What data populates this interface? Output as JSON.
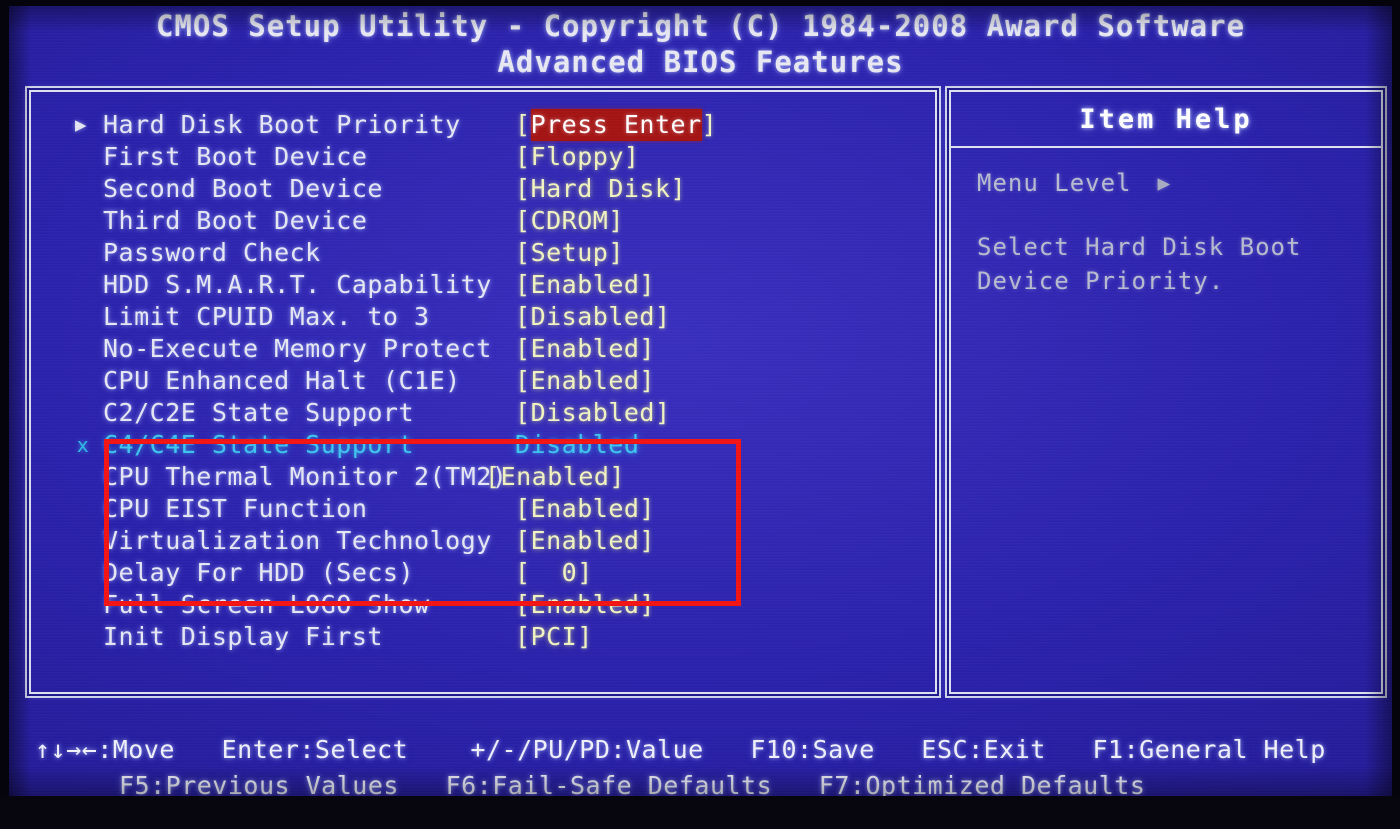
{
  "title": {
    "line1": "CMOS Setup Utility - Copyright (C) 1984-2008 Award Software",
    "line2": "Advanced BIOS Features"
  },
  "menu": {
    "items": [
      {
        "marker": "▶",
        "label": "Hard Disk Boot Priority",
        "value": "Press Enter",
        "brackets": true,
        "highlighted": true,
        "inactive": false
      },
      {
        "marker": "",
        "label": "First Boot Device",
        "value": "Floppy",
        "brackets": true,
        "highlighted": false,
        "inactive": false
      },
      {
        "marker": "",
        "label": "Second Boot Device",
        "value": "Hard Disk",
        "brackets": true,
        "highlighted": false,
        "inactive": false
      },
      {
        "marker": "",
        "label": "Third Boot Device",
        "value": "CDROM",
        "brackets": true,
        "highlighted": false,
        "inactive": false
      },
      {
        "marker": "",
        "label": "Password Check",
        "value": "Setup",
        "brackets": true,
        "highlighted": false,
        "inactive": false
      },
      {
        "marker": "",
        "label": "HDD S.M.A.R.T. Capability",
        "value": "Enabled",
        "brackets": true,
        "highlighted": false,
        "inactive": false
      },
      {
        "marker": "",
        "label": "Limit CPUID Max. to 3",
        "value": "Disabled",
        "brackets": true,
        "highlighted": false,
        "inactive": false
      },
      {
        "marker": "",
        "label": "No-Execute Memory Protect",
        "value": "Enabled",
        "brackets": true,
        "highlighted": false,
        "inactive": false
      },
      {
        "marker": "",
        "label": "CPU Enhanced Halt (C1E)",
        "value": "Enabled",
        "brackets": true,
        "highlighted": false,
        "inactive": false
      },
      {
        "marker": "",
        "label": "C2/C2E State Support",
        "value": "Disabled",
        "brackets": true,
        "highlighted": false,
        "inactive": false
      },
      {
        "marker": "x",
        "label": "C4/C4E State Support",
        "value": "Disabled",
        "brackets": false,
        "highlighted": false,
        "inactive": true
      },
      {
        "marker": "",
        "label": "CPU Thermal Monitor 2(TM2)",
        "value": "Enabled",
        "brackets": true,
        "highlighted": false,
        "inactive": false,
        "no_gap": true
      },
      {
        "marker": "",
        "label": "CPU EIST Function",
        "value": "Enabled",
        "brackets": true,
        "highlighted": false,
        "inactive": false
      },
      {
        "marker": "",
        "label": "Virtualization Technology",
        "value": "Enabled",
        "brackets": true,
        "highlighted": false,
        "inactive": false
      },
      {
        "marker": "",
        "label": "Delay For HDD (Secs)",
        "value": "  0",
        "brackets": true,
        "highlighted": false,
        "inactive": false
      },
      {
        "marker": "",
        "label": "Full Screen LOGO Show",
        "value": "Enabled",
        "brackets": true,
        "highlighted": false,
        "inactive": false
      },
      {
        "marker": "",
        "label": "Init Display First",
        "value": "PCI",
        "brackets": true,
        "highlighted": false,
        "inactive": false
      }
    ]
  },
  "help_panel": {
    "title": "Item Help",
    "menu_level_label": "Menu Level",
    "menu_level_arrow": "▶",
    "description_lines": [
      "Select Hard Disk Boot",
      "Device Priority."
    ]
  },
  "footer": {
    "line1": "↑↓→←:Move   Enter:Select    +/-/PU/PD:Value   F10:Save   ESC:Exit   F1:General Help",
    "line2": "F5:Previous Values   F6:Fail-Safe Defaults   F7:Optimized Defaults"
  },
  "annotation": {
    "shape": "rectangle",
    "color": "#f41414",
    "encloses": [
      "CPU Enhanced Halt (C1E)",
      "C2/C2E State Support",
      "C4/C4E State Support",
      "CPU Thermal Monitor 2(TM2)",
      "CPU EIST Function"
    ]
  },
  "colors": {
    "background": "#2a21ab",
    "label_text": "#e6e8f5",
    "value_text": "#f2f4c2",
    "inactive_text": "#3fc6f0",
    "highlight_background": "#a51414",
    "highlight_text": "#ffffff",
    "border": "#dfe2f2",
    "annotation": "#f41414"
  }
}
